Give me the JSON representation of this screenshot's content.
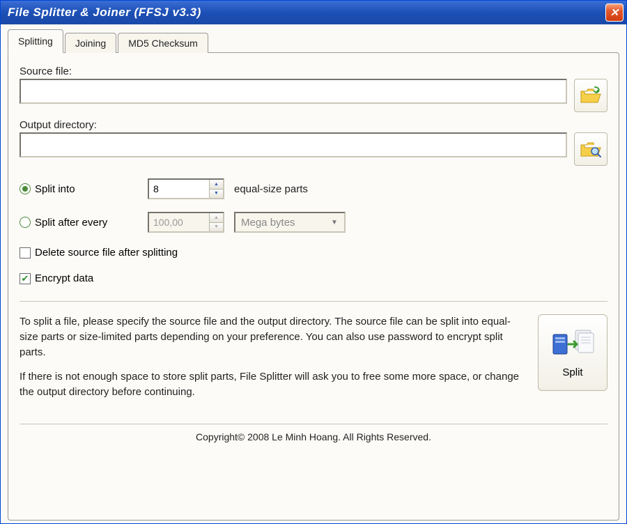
{
  "window": {
    "title": "File Splitter & Joiner (FFSJ v3.3)"
  },
  "tabs": [
    {
      "label": "Splitting",
      "active": true
    },
    {
      "label": "Joining",
      "active": false
    },
    {
      "label": "MD5 Checksum",
      "active": false
    }
  ],
  "source": {
    "label": "Source file:",
    "value": "",
    "browse_icon": "folder-open-icon"
  },
  "output": {
    "label": "Output directory:",
    "value": "",
    "browse_icon": "folder-search-icon"
  },
  "split_into": {
    "label": "Split into",
    "value": "8",
    "suffix": "equal-size parts",
    "selected": true
  },
  "split_after": {
    "label": "Split after every",
    "value": "100,00",
    "unit": "Mega bytes",
    "selected": false,
    "enabled": false
  },
  "delete_source": {
    "label": "Delete source file after splitting",
    "checked": false
  },
  "encrypt": {
    "label": "Encrypt data",
    "checked": true
  },
  "help": {
    "p1": "To split a file, please specify the source file and the output directory. The source file can be split into equal-size parts or size-limited parts depending on your preference. You can also use password to encrypt split parts.",
    "p2": "If there is not enough space to store split parts, File Splitter will ask you to free some more space, or change the output directory before continuing."
  },
  "split_button": {
    "label": "Split"
  },
  "footer": "Copyright© 2008 Le Minh Hoang. All Rights Reserved."
}
